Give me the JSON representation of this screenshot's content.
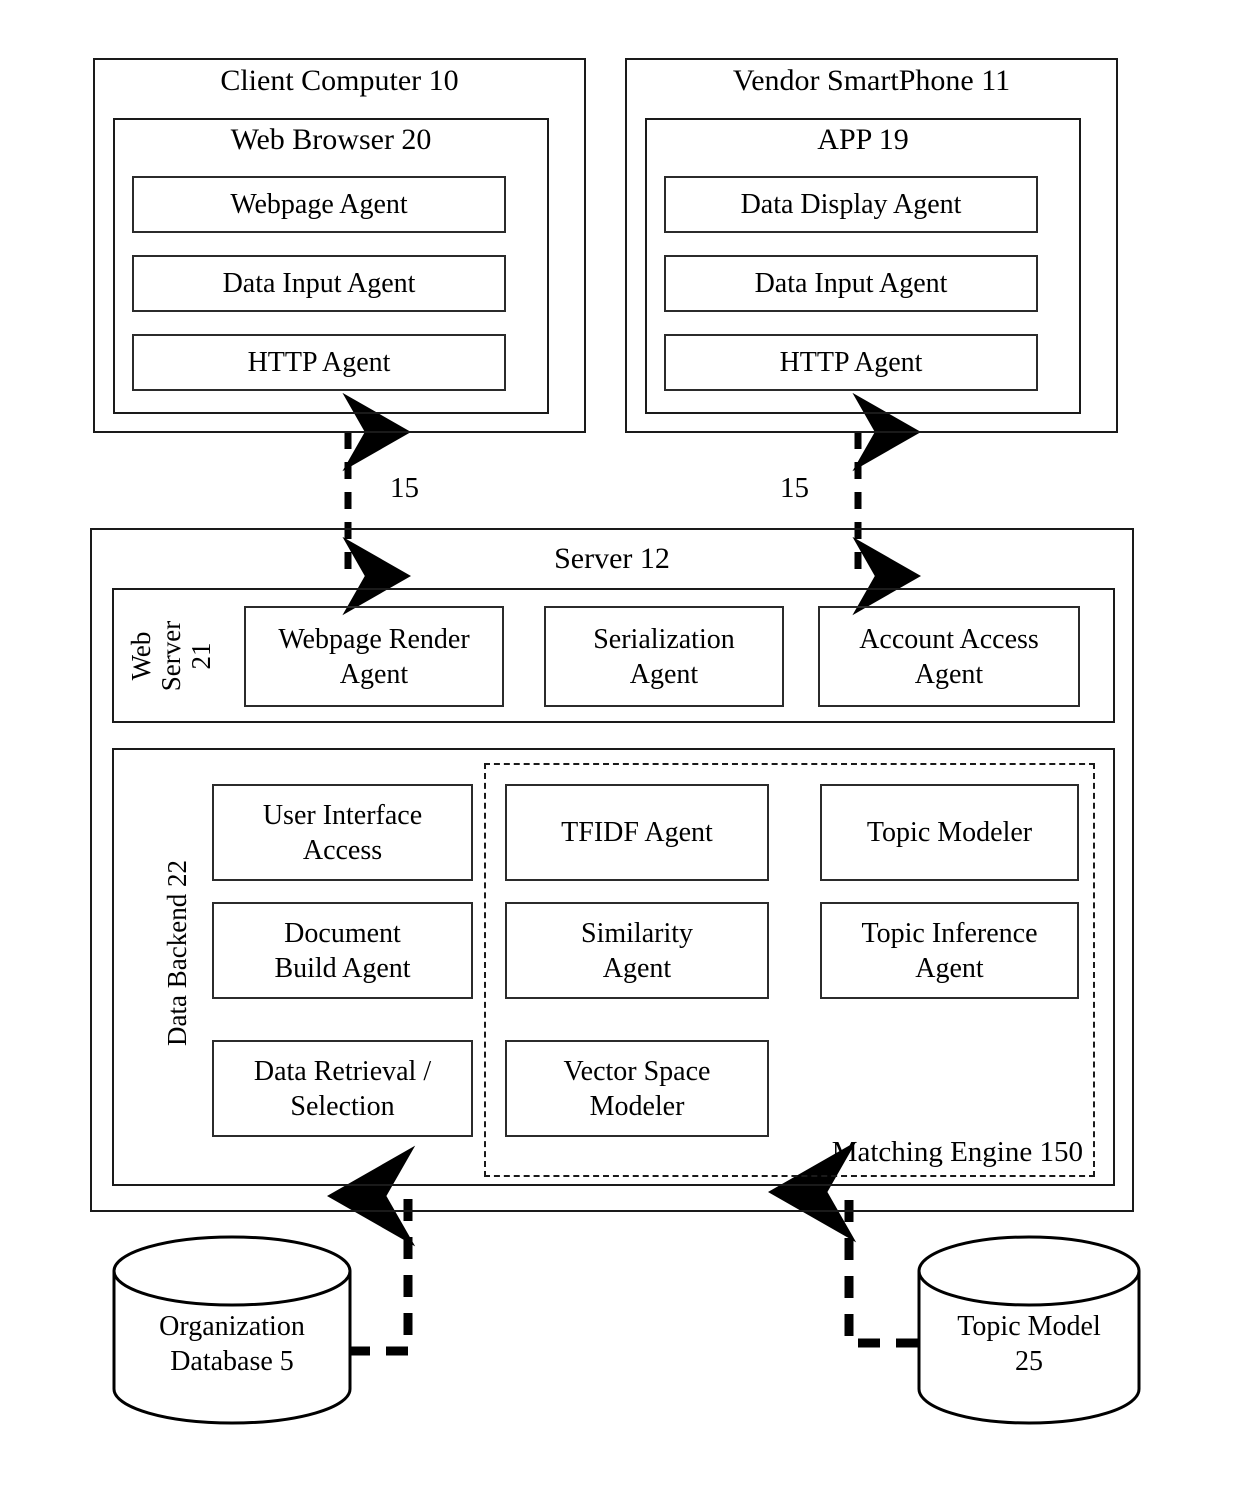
{
  "diagram": {
    "client": {
      "title": "Client Computer 10",
      "browser": {
        "title": "Web Browser 20",
        "agents": [
          "Webpage Agent",
          "Data Input Agent",
          "HTTP Agent"
        ]
      }
    },
    "vendor": {
      "title": "Vendor SmartPhone 11",
      "app": {
        "title": "APP 19",
        "agents": [
          "Data Display Agent",
          "Data Input Agent",
          "HTTP Agent"
        ]
      }
    },
    "links": {
      "left_label": "15",
      "right_label": "15"
    },
    "server": {
      "title": "Server 12",
      "web_server": {
        "label": "Web\nServer\n21",
        "agents": [
          "Webpage Render\nAgent",
          "Serialization\nAgent",
          "Account Access\nAgent"
        ]
      },
      "data_backend": {
        "label": "Data Backend 22",
        "left_agents": [
          "User Interface\nAccess",
          "Document\nBuild Agent",
          "Data Retrieval /\nSelection"
        ],
        "matching_engine": {
          "label": "Matching Engine 150",
          "col1": [
            "TFIDF Agent",
            "Similarity\nAgent",
            "Vector Space\nModeler"
          ],
          "col2": [
            "Topic Modeler",
            "Topic Inference\nAgent"
          ]
        }
      }
    },
    "databases": [
      {
        "name": "org-database",
        "label": "Organization\nDatabase 5"
      },
      {
        "name": "topic-model",
        "label": "Topic Model\n25"
      }
    ],
    "colors": {
      "stroke": "#1a1a1a",
      "background": "#ffffff"
    }
  }
}
